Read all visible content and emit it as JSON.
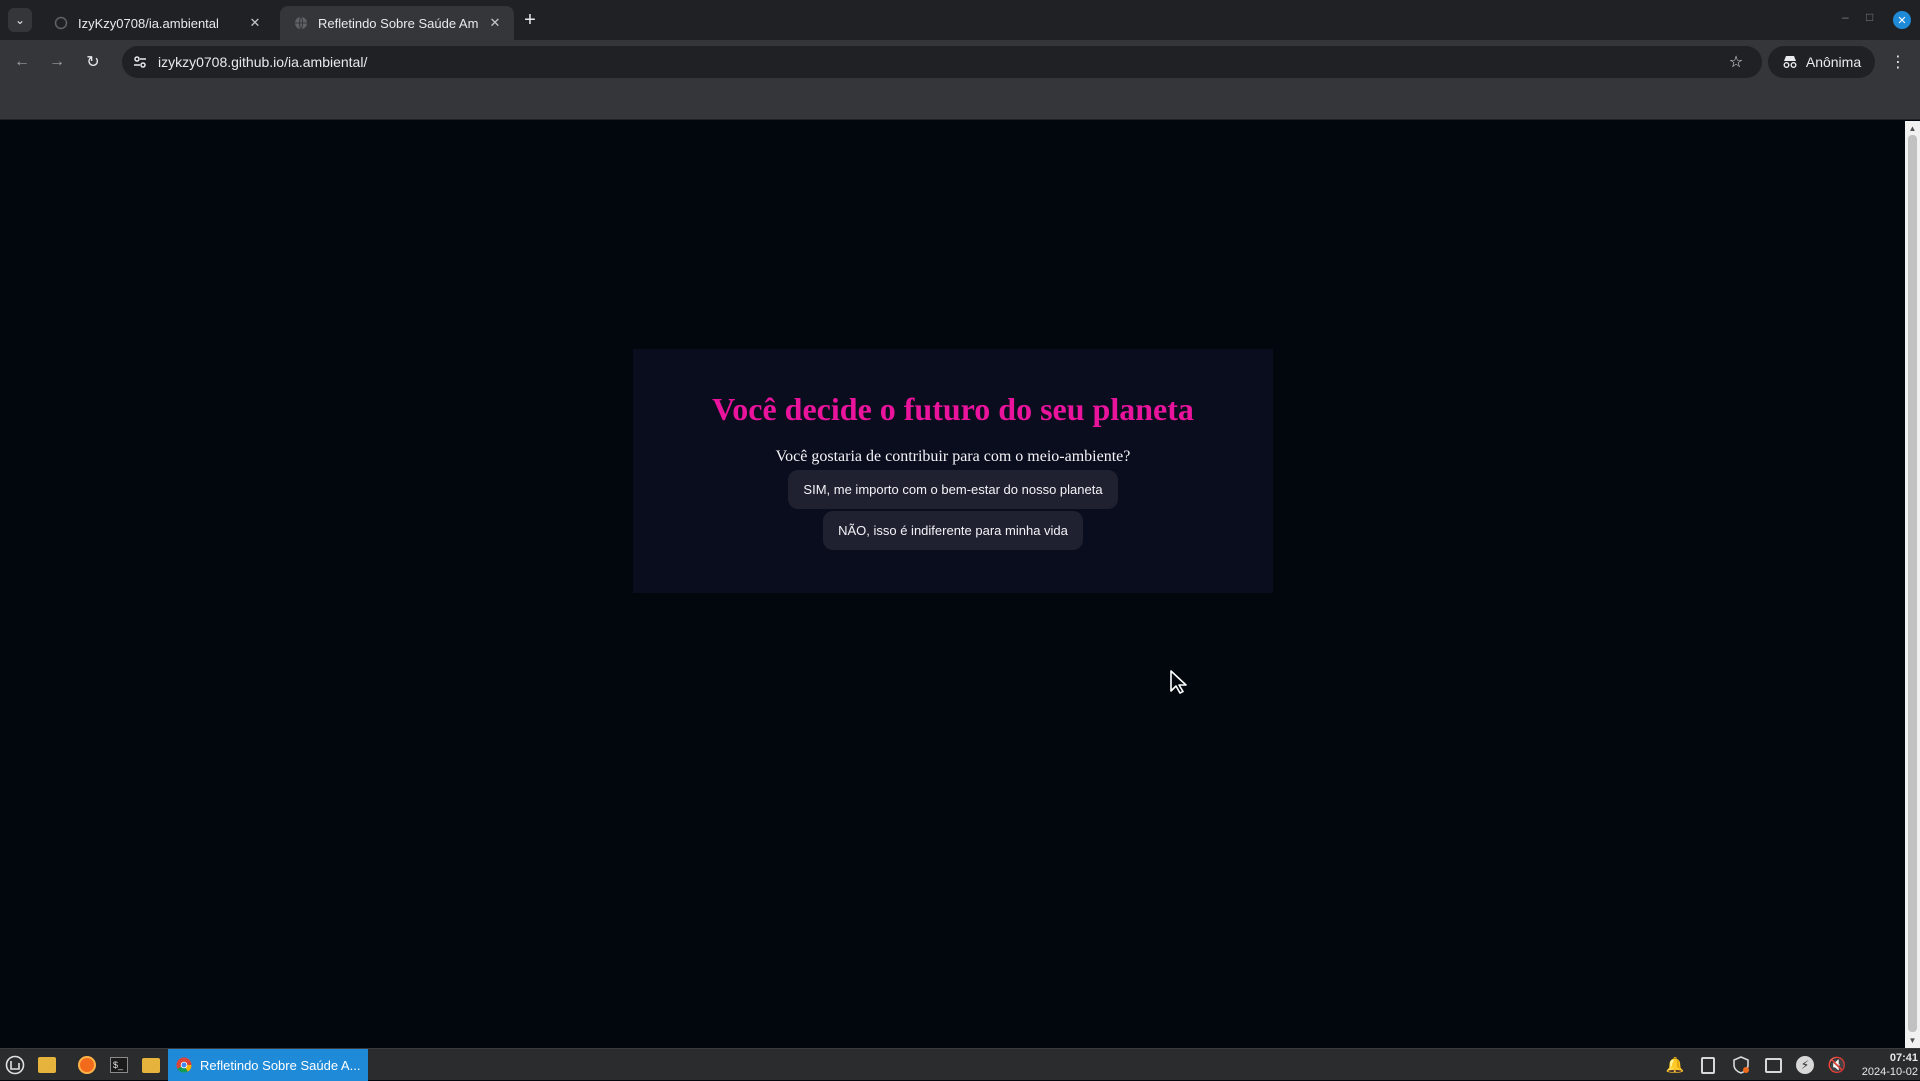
{
  "browser": {
    "tabs": [
      {
        "title": "IzyKzy0708/ia.ambiental",
        "active": false
      },
      {
        "title": "Refletindo Sobre Saúde Am",
        "active": true
      }
    ],
    "address": "izykzy0708.github.io/ia.ambiental/",
    "profile_label": "Anônima"
  },
  "page": {
    "heading": "Você decide o futuro do seu planeta",
    "question": "Você gostaria de contribuir para com o meio-ambiente?",
    "options": [
      "SIM, me importo com o bem-estar do nosso planeta",
      "NÃO, isso é indiferente para minha vida"
    ],
    "colors": {
      "background": "#02070d",
      "card": "#0a0d1e",
      "heading": "#e9139c",
      "button": "#1f2030"
    }
  },
  "taskbar": {
    "window_title": "Refletindo Sobre Saúde A...",
    "time": "07:41",
    "date": "2024-10-02",
    "accent": "#1f8ad8"
  }
}
